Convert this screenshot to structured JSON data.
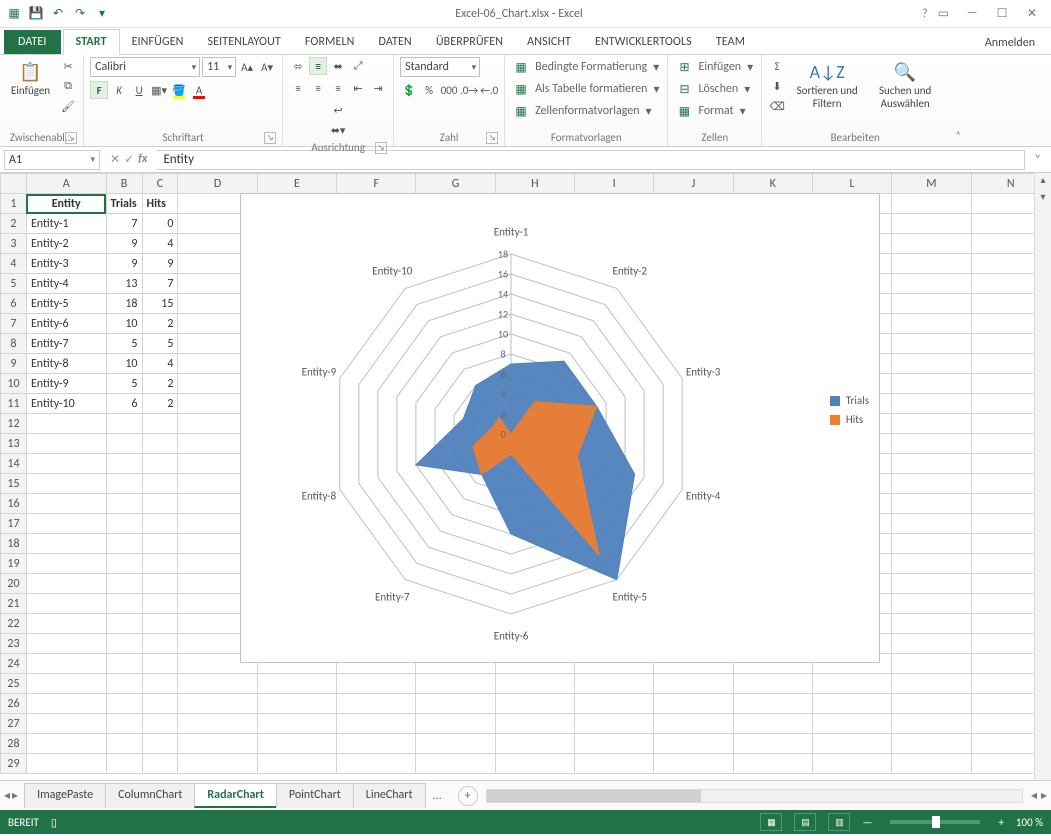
{
  "app": {
    "title": "Excel-06_Chart.xlsx - Excel",
    "signin": "Anmelden"
  },
  "qat": {
    "save": "💾",
    "undo": "↶",
    "redo": "↷"
  },
  "tabs": {
    "datei": "DATEI",
    "start": "START",
    "einfuegen": "EINFÜGEN",
    "seitenlayout": "SEITENLAYOUT",
    "formeln": "FORMELN",
    "daten": "DATEN",
    "ueberpruefen": "ÜBERPRÜFEN",
    "ansicht": "ANSICHT",
    "entwickler": "ENTWICKLERTOOLS",
    "team": "TEAM"
  },
  "ribbon": {
    "clipboard": {
      "paste": "Einfügen",
      "label": "Zwischenabl..."
    },
    "font": {
      "name": "Calibri",
      "size": "11",
      "label": "Schriftart",
      "bold": "F",
      "italic": "K",
      "underline": "U"
    },
    "align": {
      "label": "Ausrichtung"
    },
    "number": {
      "format": "Standard",
      "label": "Zahl",
      "percent": "%",
      "thousand": "000"
    },
    "styles": {
      "cond": "Bedingte Formatierung",
      "table": "Als Tabelle formatieren",
      "cell": "Zellenformatvorlagen",
      "label": "Formatvorlagen"
    },
    "cells": {
      "insert": "Einfügen",
      "delete": "Löschen",
      "format": "Format",
      "label": "Zellen"
    },
    "editing": {
      "sum": "Σ",
      "sort": "Sortieren und Filtern",
      "find": "Suchen und Auswählen",
      "label": "Bearbeiten"
    }
  },
  "namebox": "A1",
  "formula": "Entity",
  "columns": [
    "A",
    "B",
    "C",
    "D",
    "E",
    "F",
    "G",
    "H",
    "I",
    "J",
    "K",
    "L",
    "M",
    "N"
  ],
  "rows": [
    "1",
    "2",
    "3",
    "4",
    "5",
    "6",
    "7",
    "8",
    "9",
    "10",
    "11",
    "12",
    "13",
    "14",
    "15",
    "16",
    "17",
    "18",
    "19",
    "20",
    "21",
    "22",
    "23",
    "24",
    "25",
    "26",
    "27",
    "28",
    "29"
  ],
  "table": {
    "head": {
      "a": "Entity",
      "b": "Trials",
      "c": "Hits"
    },
    "rows": [
      {
        "a": "Entity-1",
        "b": "7",
        "c": "0"
      },
      {
        "a": "Entity-2",
        "b": "9",
        "c": "4"
      },
      {
        "a": "Entity-3",
        "b": "9",
        "c": "9"
      },
      {
        "a": "Entity-4",
        "b": "13",
        "c": "7"
      },
      {
        "a": "Entity-5",
        "b": "18",
        "c": "15"
      },
      {
        "a": "Entity-6",
        "b": "10",
        "c": "2"
      },
      {
        "a": "Entity-7",
        "b": "5",
        "c": "5"
      },
      {
        "a": "Entity-8",
        "b": "10",
        "c": "4"
      },
      {
        "a": "Entity-9",
        "b": "5",
        "c": "2"
      },
      {
        "a": "Entity-10",
        "b": "6",
        "c": "2"
      }
    ]
  },
  "chart_data": {
    "type": "radar",
    "categories": [
      "Entity-1",
      "Entity-2",
      "Entity-3",
      "Entity-4",
      "Entity-5",
      "Entity-6",
      "Entity-7",
      "Entity-8",
      "Entity-9",
      "Entity-10"
    ],
    "series": [
      {
        "name": "Trials",
        "color": "#4f81bd",
        "values": [
          7,
          9,
          9,
          13,
          18,
          10,
          5,
          10,
          5,
          6
        ]
      },
      {
        "name": "Hits",
        "color": "#ed7d31",
        "values": [
          0,
          4,
          9,
          7,
          15,
          2,
          5,
          4,
          2,
          2
        ]
      }
    ],
    "ticks": [
      0,
      2,
      4,
      6,
      8,
      10,
      12,
      14,
      16,
      18
    ],
    "max": 18
  },
  "sheets": {
    "tabs": [
      "ImagePaste",
      "ColumnChart",
      "RadarChart",
      "PointChart",
      "LineChart"
    ],
    "more": "...",
    "active": "RadarChart"
  },
  "status": {
    "ready": "BEREIT",
    "zoom": "100 %"
  }
}
